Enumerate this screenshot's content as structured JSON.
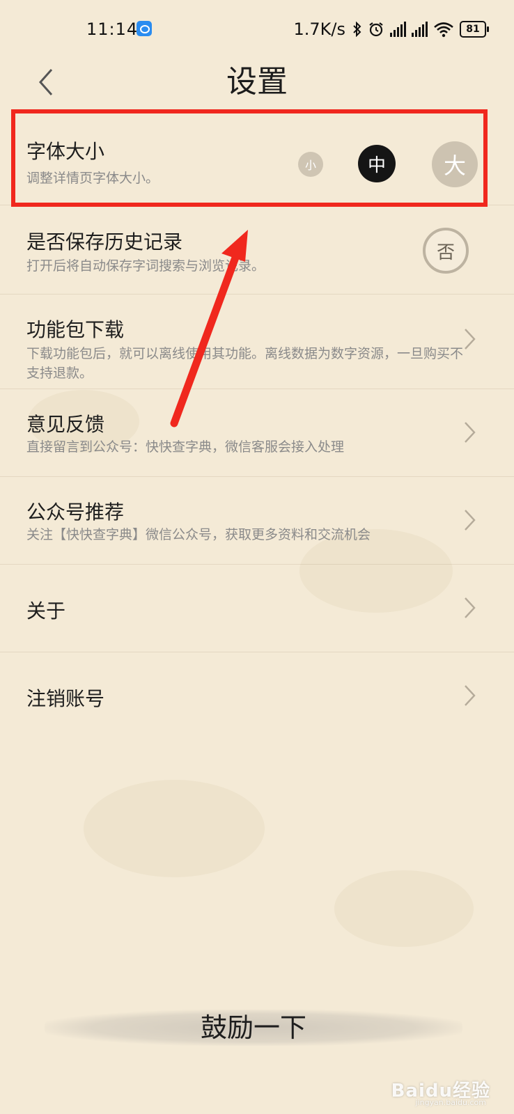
{
  "status_bar": {
    "time": "11:14",
    "net_speed": "1.7K/s",
    "battery": "81"
  },
  "header": {
    "title": "设置"
  },
  "settings": {
    "font_size": {
      "title": "字体大小",
      "subtitle": "调整详情页字体大小。",
      "options": [
        "小",
        "中",
        "大"
      ],
      "selected": "中"
    },
    "history": {
      "title": "是否保存历史记录",
      "subtitle": "打开后将自动保存字词搜索与浏览记录。",
      "toggle_label": "否"
    },
    "download": {
      "title": "功能包下载",
      "subtitle": "下载功能包后，就可以离线使用其功能。离线数据为数字资源，一旦购买不支持退款。"
    },
    "feedback": {
      "title": "意见反馈",
      "subtitle": "直接留言到公众号：快快查字典，微信客服会接入处理"
    },
    "recommend": {
      "title": "公众号推荐",
      "subtitle": "关注【快快查字典】微信公众号，获取更多资料和交流机会"
    },
    "about": {
      "title": "关于"
    },
    "logout": {
      "title": "注销账号"
    }
  },
  "footer": {
    "cheer_label": "鼓励一下"
  },
  "watermark": {
    "text": "Baidu经验",
    "url": "jingyan.baidu.com"
  },
  "colors": {
    "background": "#f4ead6",
    "highlight": "#f0281e",
    "selected_dot": "#151515"
  }
}
